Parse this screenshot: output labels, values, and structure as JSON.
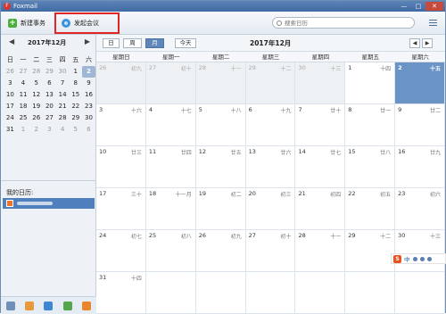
{
  "app": {
    "title": "Foxmail",
    "logo": "F"
  },
  "window_controls": {
    "minimize": "—",
    "maximize": "□",
    "close": "✕"
  },
  "toolbar": {
    "new_task": "新建事务",
    "new_meeting": "发起会议",
    "search_placeholder": "搜索日历"
  },
  "mini_calendar": {
    "title": "2017年12月",
    "prev": "◀",
    "next": "▶",
    "weekdays": [
      "日",
      "一",
      "二",
      "三",
      "四",
      "五",
      "六"
    ],
    "weeks": [
      [
        "26",
        "27",
        "28",
        "29",
        "30",
        "1",
        "2"
      ],
      [
        "3",
        "4",
        "5",
        "6",
        "7",
        "8",
        "9"
      ],
      [
        "10",
        "11",
        "12",
        "13",
        "14",
        "15",
        "16"
      ],
      [
        "17",
        "18",
        "19",
        "20",
        "21",
        "22",
        "23"
      ],
      [
        "24",
        "25",
        "26",
        "27",
        "28",
        "29",
        "30"
      ],
      [
        "31",
        "1",
        "2",
        "3",
        "4",
        "5",
        "6"
      ]
    ]
  },
  "my_calendars": {
    "title": "我的日历:"
  },
  "view": {
    "day": "日",
    "week": "周",
    "month": "月",
    "today": "今天",
    "month_title": "2017年12月",
    "prev": "◀",
    "next": "▶"
  },
  "week_header": [
    "星期日",
    "星期一",
    "星期二",
    "星期三",
    "星期四",
    "星期五",
    "星期六"
  ],
  "month_grid": [
    [
      {
        "d": "26",
        "l": "初九"
      },
      {
        "d": "27",
        "l": "初十"
      },
      {
        "d": "28",
        "l": "十一"
      },
      {
        "d": "29",
        "l": "十二"
      },
      {
        "d": "30",
        "l": "十三"
      },
      {
        "d": "1",
        "l": "十四"
      },
      {
        "d": "2",
        "l": "十五"
      }
    ],
    [
      {
        "d": "3",
        "l": "十六"
      },
      {
        "d": "4",
        "l": "十七"
      },
      {
        "d": "5",
        "l": "十八"
      },
      {
        "d": "6",
        "l": "十九"
      },
      {
        "d": "7",
        "l": "廿十"
      },
      {
        "d": "8",
        "l": "廿一"
      },
      {
        "d": "9",
        "l": "廿二"
      }
    ],
    [
      {
        "d": "10",
        "l": "廿三"
      },
      {
        "d": "11",
        "l": "廿四"
      },
      {
        "d": "12",
        "l": "廿五"
      },
      {
        "d": "13",
        "l": "廿六"
      },
      {
        "d": "14",
        "l": "廿七"
      },
      {
        "d": "15",
        "l": "廿八"
      },
      {
        "d": "16",
        "l": "廿九"
      }
    ],
    [
      {
        "d": "17",
        "l": "三十"
      },
      {
        "d": "18",
        "l": "十一月"
      },
      {
        "d": "19",
        "l": "初二"
      },
      {
        "d": "20",
        "l": "初三"
      },
      {
        "d": "21",
        "l": "初四"
      },
      {
        "d": "22",
        "l": "初五"
      },
      {
        "d": "23",
        "l": "初六"
      }
    ],
    [
      {
        "d": "24",
        "l": "初七"
      },
      {
        "d": "25",
        "l": "初八"
      },
      {
        "d": "26",
        "l": "初九"
      },
      {
        "d": "27",
        "l": "初十"
      },
      {
        "d": "28",
        "l": "十一"
      },
      {
        "d": "29",
        "l": "十二"
      },
      {
        "d": "30",
        "l": "十三"
      }
    ],
    [
      {
        "d": "31",
        "l": "十四"
      },
      {
        "d": "",
        "l": ""
      },
      {
        "d": "",
        "l": ""
      },
      {
        "d": "",
        "l": ""
      },
      {
        "d": "",
        "l": ""
      },
      {
        "d": "",
        "l": ""
      },
      {
        "d": "",
        "l": ""
      }
    ]
  ],
  "ime": {
    "logo": "S",
    "lang": "中"
  },
  "colors": {
    "accent": "#5f86b9",
    "today": "#6a93c6",
    "highlight_border": "#e02525"
  }
}
